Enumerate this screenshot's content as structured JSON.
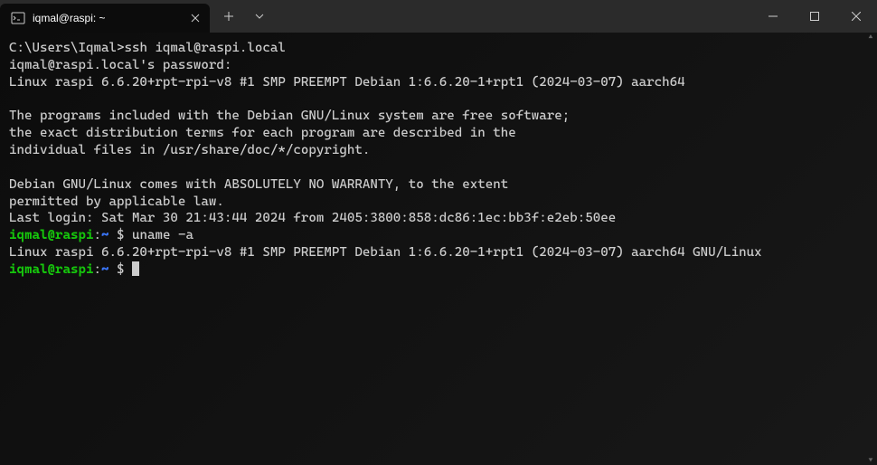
{
  "tab": {
    "title": "iqmal@raspi: ~"
  },
  "terminal": {
    "line1_prompt": "C:\\Users\\Iqmal>",
    "line1_cmd": "ssh iqmal@raspi.local",
    "line2": "iqmal@raspi.local's password:",
    "line3": "Linux raspi 6.6.20+rpt-rpi-v8 #1 SMP PREEMPT Debian 1:6.6.20-1+rpt1 (2024-03-07) aarch64",
    "line4": "",
    "line5": "The programs included with the Debian GNU/Linux system are free software;",
    "line6": "the exact distribution terms for each program are described in the",
    "line7": "individual files in /usr/share/doc/*/copyright.",
    "line8": "",
    "line9": "Debian GNU/Linux comes with ABSOLUTELY NO WARRANTY, to the extent",
    "line10": "permitted by applicable law.",
    "line11": "Last login: Sat Mar 30 21:43:44 2024 from 2405:3800:858:dc86:1ec:bb3f:e2eb:50ee",
    "prompt1_user": "iqmal@raspi",
    "prompt1_colon": ":",
    "prompt1_path": "~",
    "prompt1_dollar": " $ ",
    "prompt1_cmd": "uname -a",
    "line13": "Linux raspi 6.6.20+rpt-rpi-v8 #1 SMP PREEMPT Debian 1:6.6.20-1+rpt1 (2024-03-07) aarch64 GNU/Linux",
    "prompt2_user": "iqmal@raspi",
    "prompt2_colon": ":",
    "prompt2_path": "~",
    "prompt2_dollar": " $ "
  }
}
